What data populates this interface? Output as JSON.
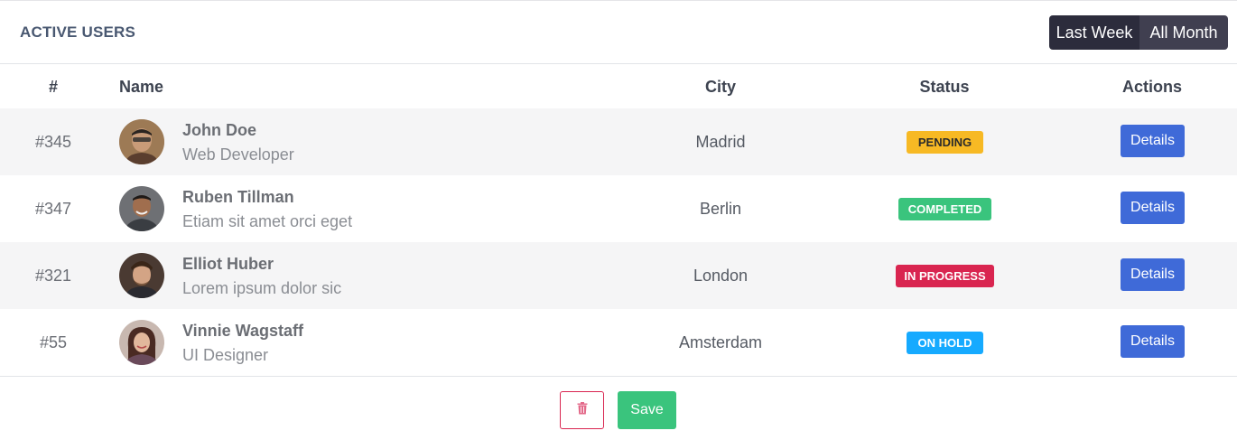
{
  "header": {
    "title": "ACTIVE USERS",
    "filters": [
      "Last Week",
      "All Month"
    ]
  },
  "table": {
    "columns": [
      "#",
      "Name",
      "City",
      "Status",
      "Actions"
    ],
    "rows": [
      {
        "id": "#345",
        "name": "John Doe",
        "subtitle": "Web Developer",
        "city": "Madrid",
        "status": "PENDING",
        "action": "Details"
      },
      {
        "id": "#347",
        "name": "Ruben Tillman",
        "subtitle": "Etiam sit amet orci eget",
        "city": "Berlin",
        "status": "COMPLETED",
        "action": "Details"
      },
      {
        "id": "#321",
        "name": "Elliot Huber",
        "subtitle": "Lorem ipsum dolor sic",
        "city": "London",
        "status": "IN PROGRESS",
        "action": "Details"
      },
      {
        "id": "#55",
        "name": "Vinnie Wagstaff",
        "subtitle": "UI Designer",
        "city": "Amsterdam",
        "status": "ON HOLD",
        "action": "Details"
      }
    ]
  },
  "footer": {
    "delete_icon": "trash-icon",
    "save_label": "Save"
  },
  "colors": {
    "pending": "#f7b924",
    "completed": "#3ac47d",
    "in_progress": "#d92550",
    "on_hold": "#16aaff",
    "primary": "#3f6ad8"
  }
}
